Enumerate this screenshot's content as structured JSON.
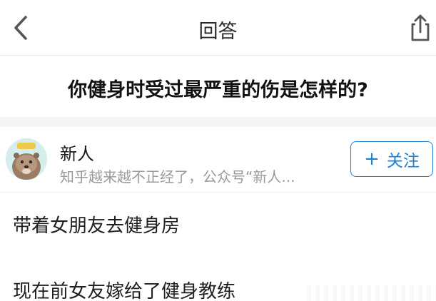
{
  "nav": {
    "title": "回答",
    "back_icon": "chevron-left-icon",
    "share_icon": "share-icon"
  },
  "question": {
    "title": "你健身时受过最严重的伤是怎样的?"
  },
  "author": {
    "name": "新人",
    "bio": "知乎越来越不正经了，公众号“新人...",
    "avatar_icon": "otter-avatar",
    "follow_plus": "+",
    "follow_label": "关注"
  },
  "answer": {
    "paragraphs": [
      "带着女朋友去健身房",
      "现在前女友嫁给了健身教练"
    ]
  },
  "colors": {
    "accent": "#1f7fd6",
    "muted_text": "#9a9a9a",
    "divider": "#f4f4f6"
  }
}
